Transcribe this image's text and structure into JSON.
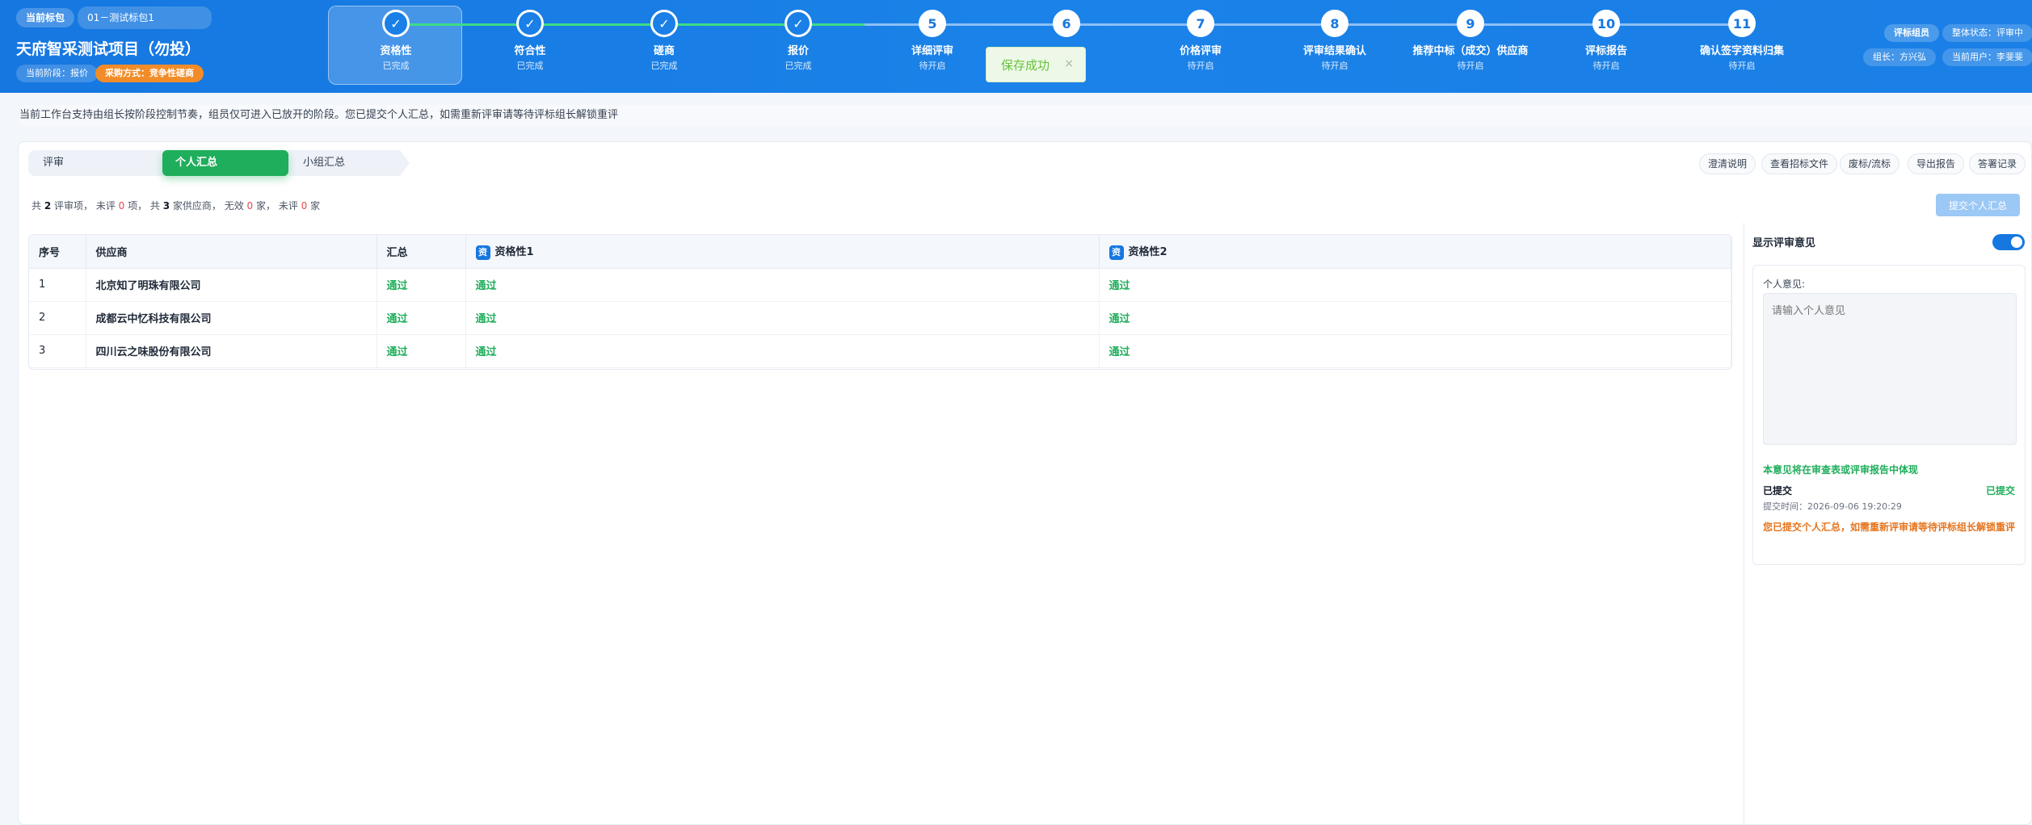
{
  "header": {
    "current_package_label": "当前标包",
    "current_package_value": "01－测试标包1",
    "project_title": "天府智采测试项目（勿投）",
    "current_stage": "当前阶段：报价",
    "procurement_method": "采购方式：竞争性磋商",
    "steps": [
      {
        "num": "✓",
        "name": "资格性",
        "status": "已完成"
      },
      {
        "num": "✓",
        "name": "符合性",
        "status": "已完成"
      },
      {
        "num": "✓",
        "name": "磋商",
        "status": "已完成"
      },
      {
        "num": "✓",
        "name": "报价",
        "status": "已完成"
      },
      {
        "num": "5",
        "name": "详细评审",
        "status": "待开启"
      },
      {
        "num": "6",
        "name": "",
        "status": ""
      },
      {
        "num": "7",
        "name": "价格评审",
        "status": "待开启"
      },
      {
        "num": "8",
        "name": "评审结果确认",
        "status": "待开启"
      },
      {
        "num": "9",
        "name": "推荐中标（成交）供应商",
        "status": "待开启"
      },
      {
        "num": "10",
        "name": "评标报告",
        "status": "待开启"
      },
      {
        "num": "11",
        "name": "确认签字资料归集",
        "status": "待开启"
      }
    ],
    "role_badge": "评标组员",
    "overall_status": "整体状态：评审中",
    "leader": "组长：方兴弘",
    "current_user": "当前用户：李斐斐"
  },
  "toast": {
    "message": "保存成功",
    "close": "×"
  },
  "notice": "当前工作台支持由组长按阶段控制节奏，组员仅可进入已放开的阶段。您已提交个人汇总，如需重新评审请等待评标组长解锁重评",
  "tabs": {
    "review": "评审",
    "personal": "个人汇总",
    "group": "小组汇总"
  },
  "tools": [
    "澄清说明",
    "查看招标文件",
    "废标/流标",
    "导出报告",
    "答署记录"
  ],
  "summary": {
    "p1": "共 ",
    "items": "2",
    "p2": " 评审项， 未评 ",
    "unreviewed": "0",
    "p3": " 项， 共 ",
    "suppliers": "3",
    "p4": " 家供应商， 无效 ",
    "invalid": "0",
    "p5": " 家， 未评 ",
    "unrated": "0",
    "p6": " 家"
  },
  "submit_button": "提交个人汇总",
  "table": {
    "headers": {
      "idx": "序号",
      "supplier": "供应商",
      "total": "汇总",
      "q1": "资格性1",
      "q2": "资格性2",
      "q_icon": "资"
    },
    "rows": [
      {
        "idx": "1",
        "supplier": "北京知了明珠有限公司",
        "total": "通过",
        "q1": "通过",
        "q2": "通过"
      },
      {
        "idx": "2",
        "supplier": "成都云中忆科技有限公司",
        "total": "通过",
        "q1": "通过",
        "q2": "通过"
      },
      {
        "idx": "3",
        "supplier": "四川云之味股份有限公司",
        "total": "通过",
        "q1": "通过",
        "q2": "通过"
      }
    ]
  },
  "side": {
    "title": "显示评审意见",
    "toggle_on": true,
    "opinion_label": "个人意见:",
    "placeholder": "请输入个人意见",
    "hint": "本意见将在审查表或评审报告中体现",
    "submitted": "已提交",
    "submitted_tag": "已提交",
    "submit_time": "提交时间：2026-09-06 19:20:29",
    "warning": "您已提交个人汇总，如需重新评审请等待评标组长解锁重评"
  },
  "colors": {
    "primary": "#1677e0",
    "success": "#1fae5b",
    "warning": "#f28c28",
    "danger": "#e5484d"
  }
}
